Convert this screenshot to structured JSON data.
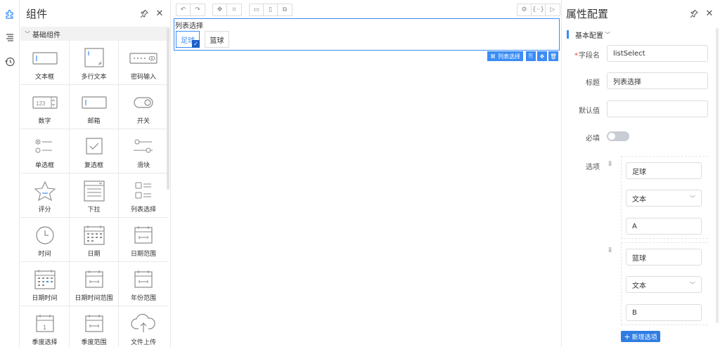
{
  "left_panel": {
    "title": "组件",
    "group": "基础组件",
    "components": [
      {
        "label": "文本框",
        "icon": "text-field-icon"
      },
      {
        "label": "多行文本",
        "icon": "textarea-icon"
      },
      {
        "label": "密码输入",
        "icon": "password-icon"
      },
      {
        "label": "数字",
        "icon": "number-icon"
      },
      {
        "label": "邮箱",
        "icon": "email-icon"
      },
      {
        "label": "开关",
        "icon": "switch-icon"
      },
      {
        "label": "单选框",
        "icon": "radio-icon"
      },
      {
        "label": "复选框",
        "icon": "checkbox-icon"
      },
      {
        "label": "滑块",
        "icon": "slider-icon"
      },
      {
        "label": "评分",
        "icon": "star-icon"
      },
      {
        "label": "下拉",
        "icon": "dropdown-icon"
      },
      {
        "label": "列表选择",
        "icon": "list-select-icon"
      },
      {
        "label": "时间",
        "icon": "clock-icon"
      },
      {
        "label": "日期",
        "icon": "calendar-icon"
      },
      {
        "label": "日期范围",
        "icon": "date-range-icon"
      },
      {
        "label": "日期时间",
        "icon": "datetime-icon"
      },
      {
        "label": "日期时间范围",
        "icon": "datetime-range-icon"
      },
      {
        "label": "年份范围",
        "icon": "year-range-icon"
      },
      {
        "label": "季度选择",
        "icon": "quarter-icon"
      },
      {
        "label": "季度范围",
        "icon": "quarter-range-icon"
      },
      {
        "label": "文件上传",
        "icon": "upload-icon"
      }
    ]
  },
  "canvas": {
    "field_label": "列表选择",
    "options": [
      {
        "label": "足球",
        "selected": true
      },
      {
        "label": "篮球",
        "selected": false
      }
    ],
    "action_label": "列表选择"
  },
  "right_panel": {
    "title": "属性配置",
    "section": "基本配置",
    "field_name_label": "字段名",
    "field_name_value": "listSelect",
    "title_label": "标题",
    "title_value": "列表选择",
    "default_label": "默认值",
    "default_value": "",
    "required_label": "必填",
    "required": false,
    "options_label": "选项",
    "options": [
      {
        "label": "足球",
        "type": "文本",
        "value": "A"
      },
      {
        "label": "篮球",
        "type": "文本",
        "value": "B"
      }
    ],
    "add_option": "新增选项"
  },
  "colors": {
    "accent": "#3b8cf5",
    "button": "#2f7de1"
  }
}
